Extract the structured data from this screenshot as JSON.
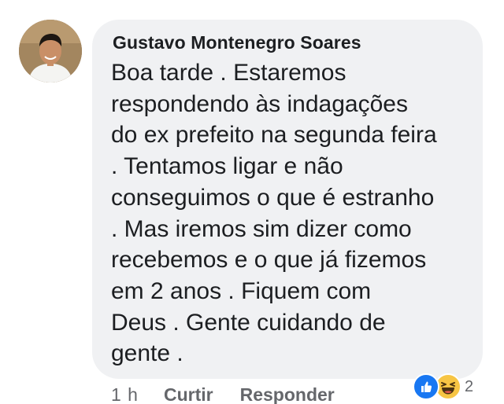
{
  "comment": {
    "author": "Gustavo Montenegro Soares",
    "text_lines": [
      "Boa tarde . Estaremos",
      "respondendo às indagações",
      "do ex prefeito na segunda feira",
      ". Tentamos ligar e não",
      "conseguimos o que é estranho",
      ". Mas iremos sim dizer como",
      "recebemos e o que já fizemos",
      "em 2 anos . Fiquem com",
      "Deus . Gente cuidando de",
      "gente ."
    ]
  },
  "actions": {
    "time": "1 h",
    "like_label": "Curtir",
    "reply_label": "Responder"
  },
  "reactions": {
    "icons": [
      "like-icon",
      "haha-icon"
    ],
    "count": "2"
  },
  "colors": {
    "bubble": "#f0f1f3",
    "text": "#1c1e21",
    "meta": "#65676b",
    "like_blue": "#1877f2",
    "haha_yellow": "#f7c544"
  }
}
